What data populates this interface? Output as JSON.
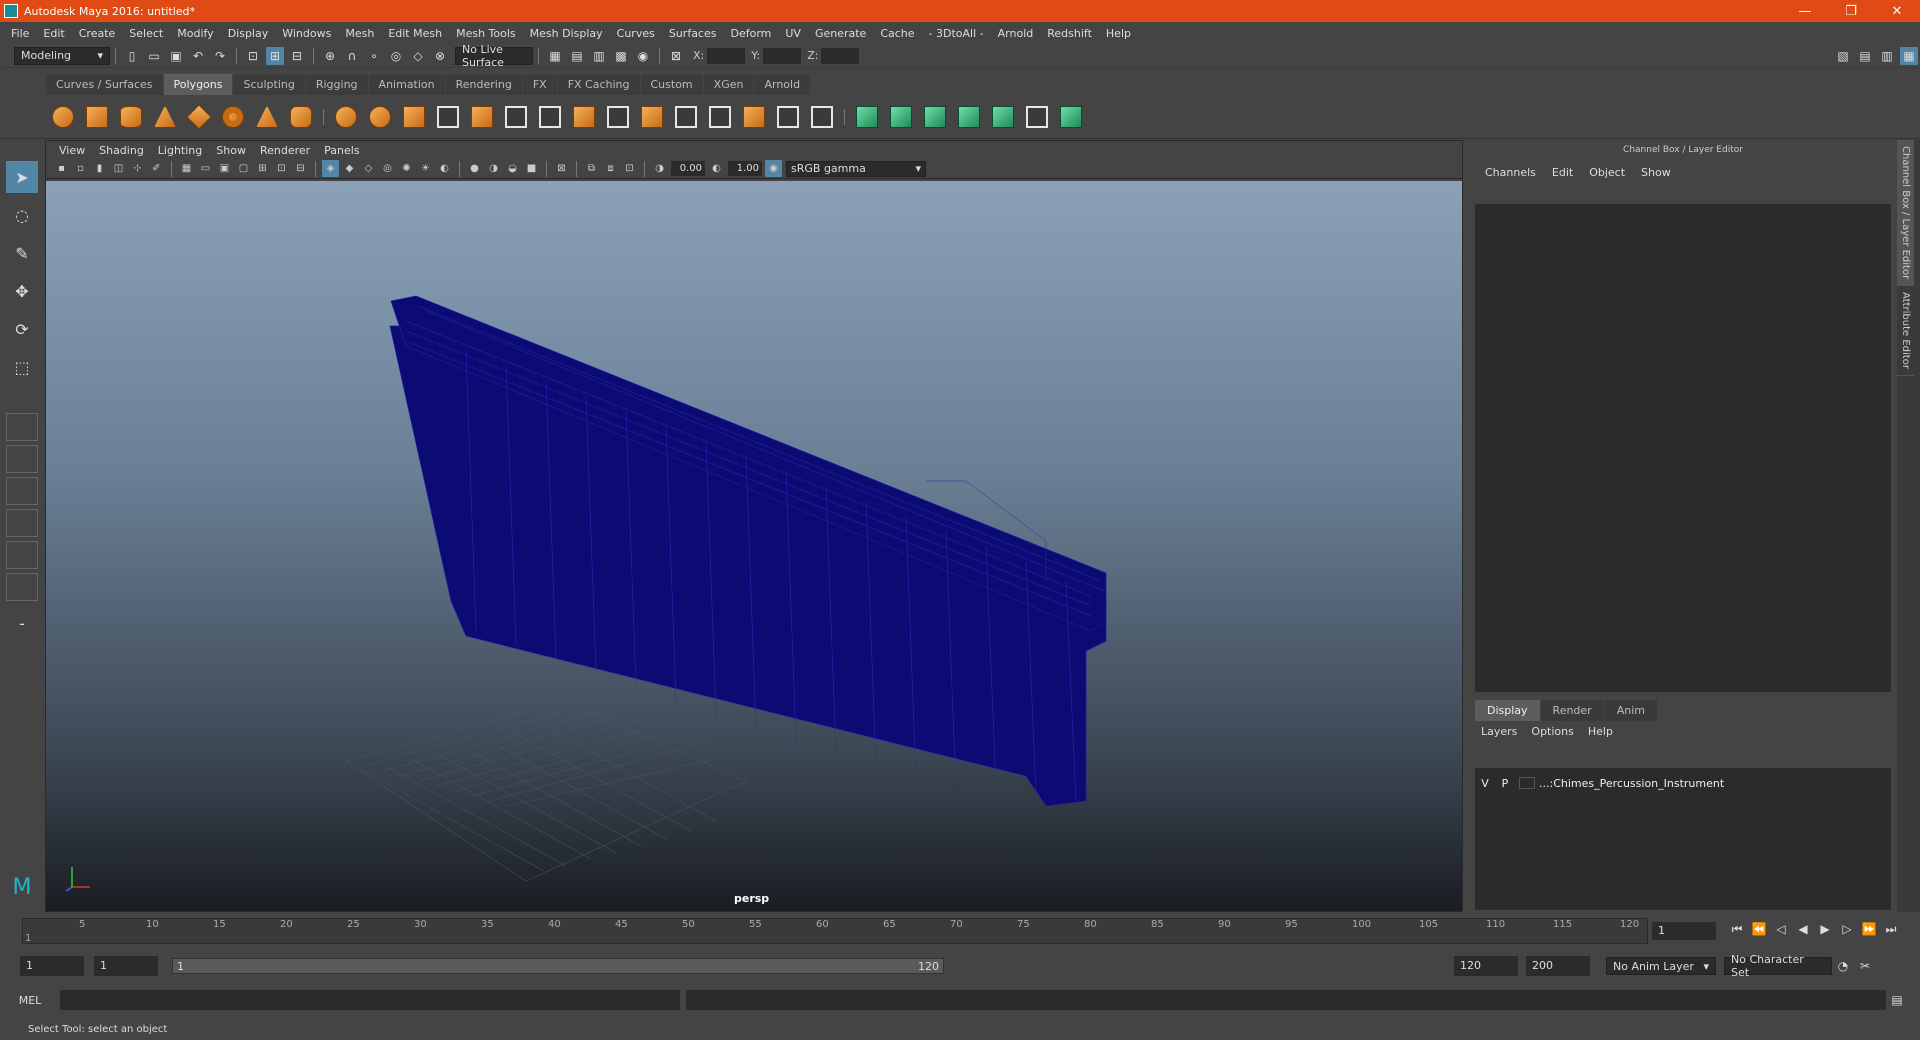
{
  "window": {
    "title": "Autodesk Maya 2016: untitled*",
    "minimize": "—",
    "restore": "❐",
    "close": "✕"
  },
  "menubar": [
    "File",
    "Edit",
    "Create",
    "Select",
    "Modify",
    "Display",
    "Windows",
    "Mesh",
    "Edit Mesh",
    "Mesh Tools",
    "Mesh Display",
    "Curves",
    "Surfaces",
    "Deform",
    "UV",
    "Generate",
    "Cache",
    "- 3DtoAll -",
    "Arnold",
    "Redshift",
    "Help"
  ],
  "statusline": {
    "mode": "Modeling",
    "live_surface": "No Live Surface",
    "x_label": "X:",
    "y_label": "Y:",
    "z_label": "Z:"
  },
  "shelf_tabs": [
    "Curves / Surfaces",
    "Polygons",
    "Sculpting",
    "Rigging",
    "Animation",
    "Rendering",
    "FX",
    "FX Caching",
    "Custom",
    "XGen",
    "Arnold"
  ],
  "active_shelf_tab": "Polygons",
  "panel": {
    "menu": [
      "View",
      "Shading",
      "Lighting",
      "Show",
      "Renderer",
      "Panels"
    ],
    "exposure": "0.00",
    "gamma": "1.00",
    "color_space": "sRGB gamma",
    "camera": "persp"
  },
  "channel_box": {
    "title": "Channel Box / Layer Editor",
    "menu": [
      "Channels",
      "Edit",
      "Object",
      "Show"
    ],
    "layer_tabs": [
      "Display",
      "Render",
      "Anim"
    ],
    "layer_menu": [
      "Layers",
      "Options",
      "Help"
    ],
    "layer": {
      "v": "V",
      "p": "P",
      "name": "...:Chimes_Percussion_Instrument"
    }
  },
  "side_tabs": [
    "Channel Box / Layer Editor",
    "Attribute Editor"
  ],
  "timeline": {
    "ticks": [
      "5",
      "10",
      "15",
      "20",
      "25",
      "30",
      "35",
      "40",
      "45",
      "50",
      "55",
      "60",
      "65",
      "70",
      "75",
      "80",
      "85",
      "90",
      "95",
      "100",
      "105",
      "110",
      "115",
      "120"
    ],
    "current_frame": "1",
    "start_marker": "1"
  },
  "range": {
    "start": "1",
    "anim_start": "1",
    "range_start": "1",
    "range_end": "120",
    "end": "120",
    "anim_end": "200",
    "anim_layer": "No Anim Layer",
    "character_set": "No Character Set"
  },
  "command_line": {
    "label": "MEL"
  },
  "help_line": "Select Tool: select an object",
  "colors": {
    "title_bar": "#e04a14",
    "wireframe": "#0b0b73",
    "accent": "#5285a6"
  }
}
